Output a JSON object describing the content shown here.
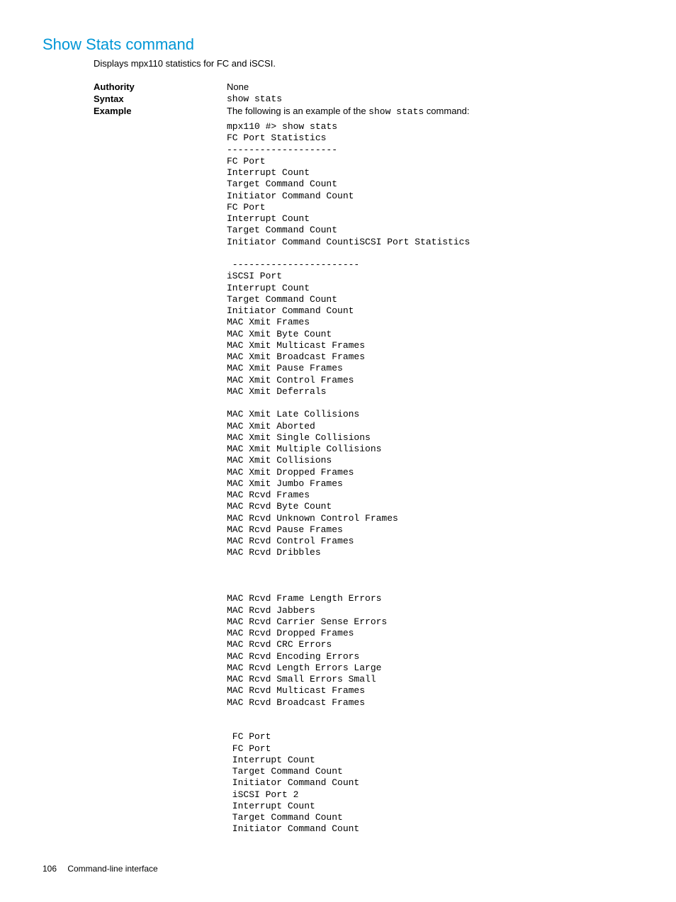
{
  "section": {
    "title": "Show Stats command",
    "intro": "Displays mpx110 statistics for FC and iSCSI."
  },
  "defs": {
    "authority": {
      "label": "Authority",
      "value": "None"
    },
    "syntax": {
      "label": "Syntax",
      "value": "show stats"
    },
    "example": {
      "label": "Example",
      "prefix": "The following is an example of the ",
      "mono": "show stats",
      "suffix": " command:"
    }
  },
  "output": "mpx110 #> show stats\nFC Port Statistics\n--------------------\nFC Port\nInterrupt Count\nTarget Command Count\nInitiator Command Count\nFC Port\nInterrupt Count\nTarget Command Count\nInitiator Command CountiSCSI Port Statistics\n\n -----------------------\niSCSI Port\nInterrupt Count\nTarget Command Count\nInitiator Command Count\nMAC Xmit Frames\nMAC Xmit Byte Count\nMAC Xmit Multicast Frames\nMAC Xmit Broadcast Frames\nMAC Xmit Pause Frames\nMAC Xmit Control Frames\nMAC Xmit Deferrals\n\nMAC Xmit Late Collisions\nMAC Xmit Aborted\nMAC Xmit Single Collisions\nMAC Xmit Multiple Collisions\nMAC Xmit Collisions\nMAC Xmit Dropped Frames\nMAC Xmit Jumbo Frames\nMAC Rcvd Frames\nMAC Rcvd Byte Count\nMAC Rcvd Unknown Control Frames\nMAC Rcvd Pause Frames\nMAC Rcvd Control Frames\nMAC Rcvd Dribbles\n\n\n\nMAC Rcvd Frame Length Errors\nMAC Rcvd Jabbers\nMAC Rcvd Carrier Sense Errors\nMAC Rcvd Dropped Frames\nMAC Rcvd CRC Errors\nMAC Rcvd Encoding Errors\nMAC Rcvd Length Errors Large\nMAC Rcvd Small Errors Small\nMAC Rcvd Multicast Frames\nMAC Rcvd Broadcast Frames\n\n\n FC Port\n FC Port\n Interrupt Count\n Target Command Count\n Initiator Command Count\n iSCSI Port 2\n Interrupt Count\n Target Command Count\n Initiator Command Count",
  "footer": {
    "page_number": "106",
    "section_name": "Command-line interface"
  }
}
